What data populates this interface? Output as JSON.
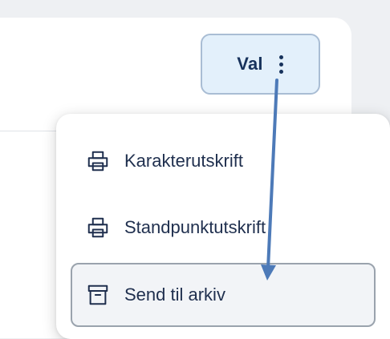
{
  "toolbar": {
    "val_label": "Val",
    "kebab_icon": "more-vertical-icon"
  },
  "menu": {
    "items": [
      {
        "label": "Karakterutskrift",
        "icon": "printer-icon",
        "hovered": false
      },
      {
        "label": "Standpunktutskrift",
        "icon": "printer-icon",
        "hovered": false
      },
      {
        "label": "Send til arkiv",
        "icon": "archive-icon",
        "hovered": true
      }
    ]
  },
  "colors": {
    "accent_button_bg": "#e3f0fb",
    "accent_button_border": "#a9bdd4",
    "text_primary": "#1f2f4e",
    "hover_item_bg": "#f2f4f7",
    "annotation_arrow": "#4d7ab8"
  }
}
